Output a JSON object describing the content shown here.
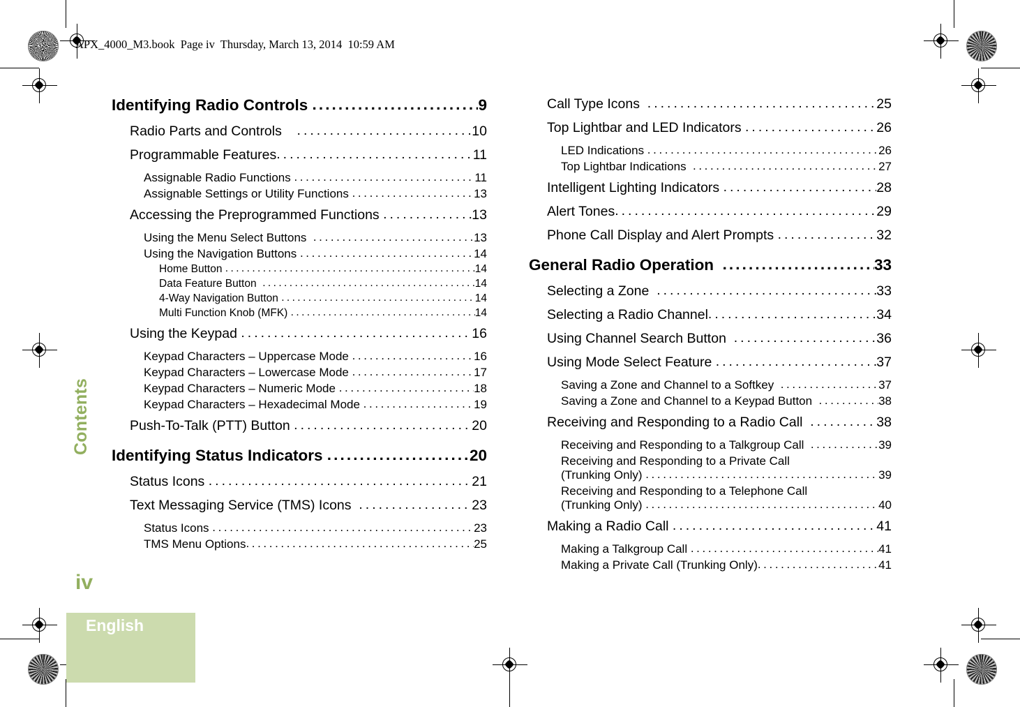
{
  "file_header": "APX_4000_M3.book  Page iv  Thursday, March 13, 2014  10:59 AM",
  "sidebar": {
    "section_label": "Contents",
    "page_number": "iv",
    "language": "English",
    "accent_color": "#92af5f",
    "language_block_color": "#ccdbae"
  },
  "toc": {
    "left_column": [
      {
        "level": "h",
        "title": "Identifying Radio Controls ",
        "page": "9",
        "spacing": "none"
      },
      {
        "level": "1",
        "title": "Radio Parts and Controls    ",
        "page": "10",
        "spacing": "none"
      },
      {
        "level": "1",
        "title": "Programmable Features",
        "page": "11",
        "spacing": "none"
      },
      {
        "level": "2",
        "title": "Assignable Radio Functions ",
        "page": "11",
        "spacing": "none"
      },
      {
        "level": "2",
        "title": "Assignable Settings or Utility Functions ",
        "page": "13",
        "spacing": "none"
      },
      {
        "level": "1",
        "title": "Accessing the Preprogrammed Functions ",
        "page": "13",
        "spacing": "small"
      },
      {
        "level": "2",
        "title": "Using the Menu Select Buttons  ",
        "page": "13",
        "spacing": "none"
      },
      {
        "level": "2",
        "title": "Using the Navigation Buttons ",
        "page": "14",
        "spacing": "none"
      },
      {
        "level": "3",
        "title": "Home Button ",
        "page": "14",
        "spacing": "none"
      },
      {
        "level": "3",
        "title": "Data Feature Button  ",
        "page": "14",
        "spacing": "none"
      },
      {
        "level": "3",
        "title": "4-Way Navigation Button ",
        "page": "14",
        "spacing": "none"
      },
      {
        "level": "3",
        "title": "Multi Function Knob (MFK) ",
        "page": "14",
        "spacing": "none"
      },
      {
        "level": "1",
        "title": "Using the Keypad ",
        "page": "16",
        "spacing": "small"
      },
      {
        "level": "2",
        "title": "Keypad Characters – Uppercase Mode ",
        "page": "16",
        "spacing": "none"
      },
      {
        "level": "2",
        "title": "Keypad Characters – Lowercase Mode ",
        "page": "17",
        "spacing": "none"
      },
      {
        "level": "2",
        "title": "Keypad Characters – Numeric Mode ",
        "page": "18",
        "spacing": "none"
      },
      {
        "level": "2",
        "title": "Keypad Characters – Hexadecimal Mode ",
        "page": "19",
        "spacing": "none"
      },
      {
        "level": "1",
        "title": "Push-To-Talk (PTT) Button ",
        "page": "20",
        "spacing": "small"
      },
      {
        "level": "h",
        "title": "Identifying Status Indicators ",
        "page": "20",
        "spacing": "before"
      },
      {
        "level": "1",
        "title": "Status Icons ",
        "page": "21",
        "spacing": "none"
      },
      {
        "level": "1",
        "title": "Text Messaging Service (TMS) Icons  ",
        "page": "23",
        "spacing": "none"
      },
      {
        "level": "2",
        "title": "Status Icons ",
        "page": "23",
        "spacing": "none"
      },
      {
        "level": "2",
        "title": "TMS Menu Options",
        "page": "25",
        "spacing": "none"
      }
    ],
    "right_column": [
      {
        "level": "1",
        "title": "Call Type Icons  ",
        "page": "25",
        "spacing": "none"
      },
      {
        "level": "1",
        "title": "Top Lightbar and LED Indicators ",
        "page": "26",
        "spacing": "none"
      },
      {
        "level": "2",
        "title": "LED Indications ",
        "page": "26",
        "spacing": "none"
      },
      {
        "level": "2",
        "title": "Top Lightbar Indications  ",
        "page": "27",
        "spacing": "none"
      },
      {
        "level": "1",
        "title": "Intelligent Lighting Indicators ",
        "page": "28",
        "spacing": "small"
      },
      {
        "level": "1",
        "title": "Alert Tones",
        "page": "29",
        "spacing": "none"
      },
      {
        "level": "1",
        "title": "Phone Call Display and Alert Prompts ",
        "page": "32",
        "spacing": "none"
      },
      {
        "level": "h",
        "title": "General Radio Operation  ",
        "page": "33",
        "spacing": "before"
      },
      {
        "level": "1",
        "title": "Selecting a Zone  ",
        "page": "33",
        "spacing": "none"
      },
      {
        "level": "1",
        "title": "Selecting a Radio Channel",
        "page": "34",
        "spacing": "none"
      },
      {
        "level": "1",
        "title": "Using Channel Search Button  ",
        "page": "36",
        "spacing": "none"
      },
      {
        "level": "1",
        "title": "Using Mode Select Feature ",
        "page": "37",
        "spacing": "none"
      },
      {
        "level": "2",
        "title": "Saving a Zone and Channel to a Softkey  ",
        "page": "37",
        "spacing": "none"
      },
      {
        "level": "2",
        "title": "Saving a Zone and Channel to a Keypad Button  ",
        "page": "38",
        "spacing": "none"
      },
      {
        "level": "1",
        "title": "Receiving and Responding to a Radio Call  ",
        "page": "38",
        "spacing": "small"
      },
      {
        "level": "2",
        "title": "Receiving and Responding to a Talkgroup Call  ",
        "page": "39",
        "spacing": "none"
      },
      {
        "level": "2",
        "title": "Receiving and Responding to a Private Call",
        "title2": "(Trunking Only) ",
        "page": "39",
        "spacing": "none",
        "wrapped": true
      },
      {
        "level": "2",
        "title": "Receiving and Responding to a Telephone Call",
        "title2": "(Trunking Only) ",
        "page": "40",
        "spacing": "none",
        "wrapped": true
      },
      {
        "level": "1",
        "title": "Making a Radio Call ",
        "page": "41",
        "spacing": "small"
      },
      {
        "level": "2",
        "title": "Making a Talkgroup Call ",
        "page": "41",
        "spacing": "none"
      },
      {
        "level": "2",
        "title": "Making a Private Call (Trunking Only)",
        "page": "41",
        "spacing": "none"
      }
    ]
  }
}
